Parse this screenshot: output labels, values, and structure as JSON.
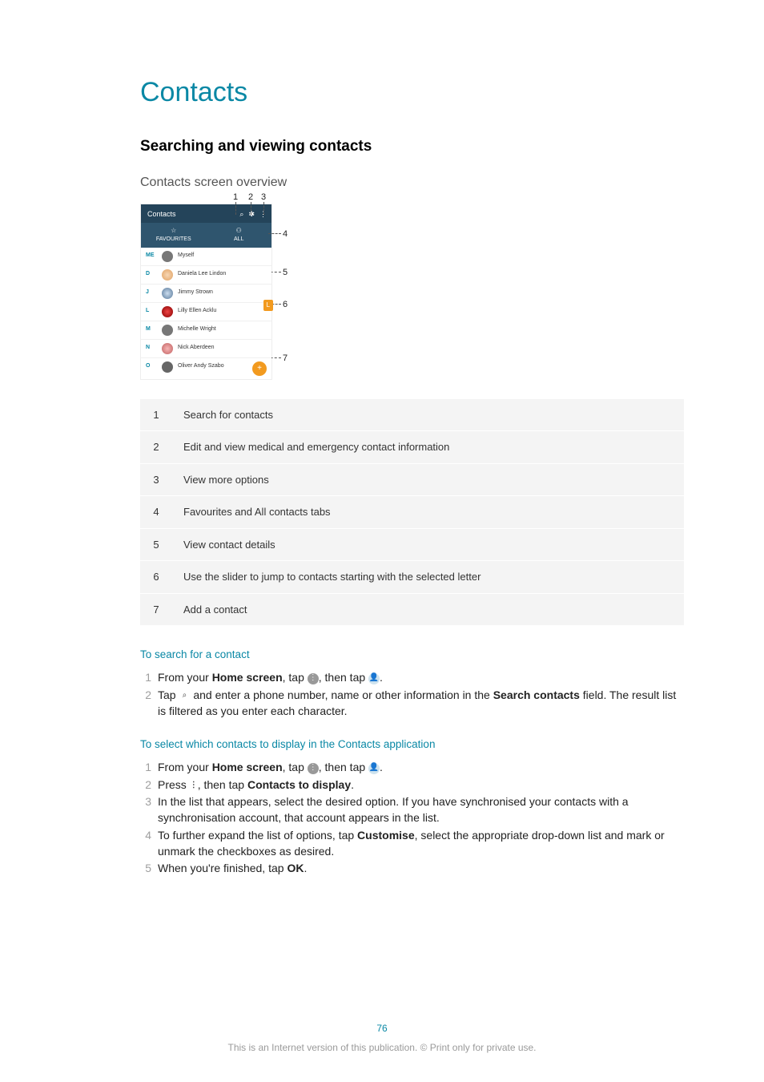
{
  "title": "Contacts",
  "section": "Searching and viewing contacts",
  "subsection": "Contacts screen overview",
  "screenshot": {
    "titlebar_label": "Contacts",
    "tab1_icon_label": "☆",
    "tab1_label": "FAVOURITES",
    "tab2_icon_label": "⚇",
    "tab2_label": "ALL",
    "rows": [
      {
        "idx": "ME",
        "name": "Myself"
      },
      {
        "idx": "D",
        "name": "Daniela Lee Lindon"
      },
      {
        "idx": "J",
        "name": "Jimmy Strown"
      },
      {
        "idx": "L",
        "name": "Lilly Ellen Acklu"
      },
      {
        "idx": "M",
        "name": "Michelle Wright"
      },
      {
        "idx": "N",
        "name": "Nick Aberdeen"
      },
      {
        "idx": "O",
        "name": "Oliver Andy Szabo"
      }
    ],
    "chip": "L",
    "fab": "+"
  },
  "callouts": {
    "c1": "1",
    "c2": "2",
    "c3": "3",
    "c4": "4",
    "c5": "5",
    "c6": "6",
    "c7": "7"
  },
  "legend": [
    {
      "n": "1",
      "t": "Search for contacts"
    },
    {
      "n": "2",
      "t": "Edit and view medical and emergency contact information"
    },
    {
      "n": "3",
      "t": "View more options"
    },
    {
      "n": "4",
      "t": "Favourites and All contacts tabs"
    },
    {
      "n": "5",
      "t": "View contact details"
    },
    {
      "n": "6",
      "t": "Use the slider to jump to contacts starting with the selected letter"
    },
    {
      "n": "7",
      "t": "Add a contact"
    }
  ],
  "task1": {
    "title": "To search for a contact",
    "s1a": "From your ",
    "s1b": "Home screen",
    "s1c": ", tap ",
    "s1d": ", then tap ",
    "s1e": ".",
    "s2a": "Tap ",
    "s2b": " and enter a phone number, name or other information in the ",
    "s2c": "Search contacts",
    "s2d": " field. The result list is filtered as you enter each character."
  },
  "task2": {
    "title": "To select which contacts to display in the Contacts application",
    "s1a": "From your ",
    "s1b": "Home screen",
    "s1c": ", tap ",
    "s1d": ", then tap ",
    "s1e": ".",
    "s2a": "Press ",
    "s2b": ", then tap ",
    "s2c": "Contacts to display",
    "s2d": ".",
    "s3": "In the list that appears, select the desired option. If you have synchronised your contacts with a synchronisation account, that account appears in the list.",
    "s4a": "To further expand the list of options, tap ",
    "s4b": "Customise",
    "s4c": ", select the appropriate drop-down list and mark or unmark the checkboxes as desired.",
    "s5a": "When you're finished, tap ",
    "s5b": "OK",
    "s5c": "."
  },
  "footer": {
    "page": "76",
    "note": "This is an Internet version of this publication. © Print only for private use."
  }
}
